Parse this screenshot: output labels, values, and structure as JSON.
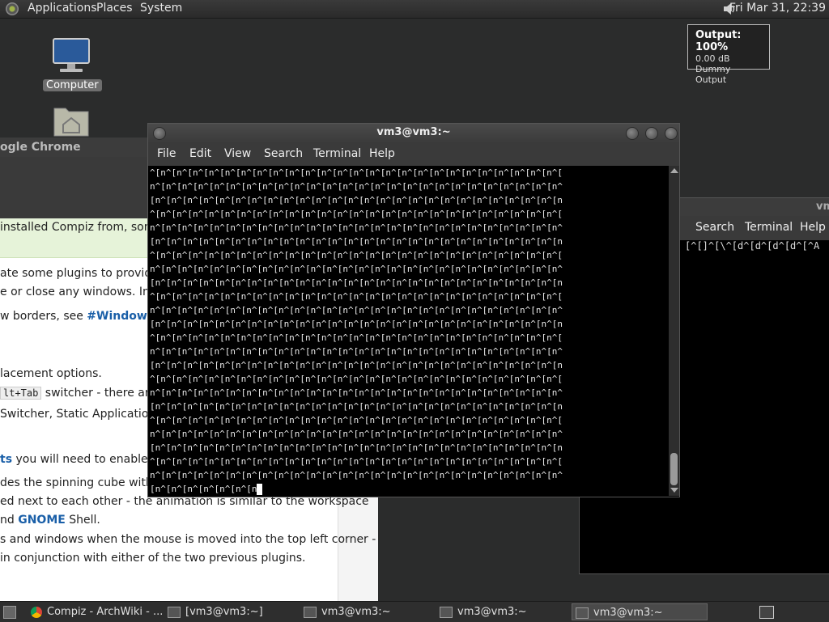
{
  "top_panel": {
    "menus": [
      "Applications",
      "Places",
      "System"
    ],
    "clock": "Fri Mar 31, 22:39"
  },
  "volume_tooltip": {
    "title": "Output: 100%",
    "db": "0.00 dB",
    "device": "Dummy Output"
  },
  "desktop": {
    "computer_label": "Computer"
  },
  "chrome_window": {
    "title_fragment": "ogle Chrome",
    "wiki_lines": [
      "installed Compiz from, some o",
      "ate some plugins to provide b",
      "e or close any windows. Impo",
      "w borders, see ",
      "lacement options.",
      "lt+Tab",
      " switcher - there are",
      "Switcher, Static Application Sw",
      "ts",
      " you will need to enable one",
      "des the spinning cube with ea",
      "ed next to each other - the animation is similar to the workspace",
      "nd ",
      "GNOME",
      " Shell.",
      "s and windows when the mouse is moved into the top left corner -",
      " in conjunction with either of the two previous plugins."
    ],
    "wiki_link": "#Window dec"
  },
  "terminal_bg": {
    "title": "vm",
    "menus": [
      "Search",
      "Terminal",
      "Help"
    ],
    "text": "[^[]^[\\^[d^[d^[d^[d^[^A"
  },
  "terminal": {
    "title": "vm3@vm3:~",
    "menus": [
      "File",
      "Edit",
      "View",
      "Search",
      "Terminal",
      "Help"
    ],
    "lines": [
      "^[n^[n^[n^[n^[n^[n^[n^[n^[n^[n^[n^[n^[n^[n^[n^[n^[n^[n^[n^[n^[n^[n^[n^[n^[n^[",
      "n^[n^[n^[n^[n^[n^[n^[n^[n^[n^[n^[n^[n^[n^[n^[n^[n^[n^[n^[n^[n^[n^[n^[n^[n^[n^",
      "[n^[n^[n^[n^[n^[n^[n^[n^[n^[n^[n^[n^[n^[n^[n^[n^[n^[n^[n^[n^[n^[n^[n^[n^[n^[n",
      "^[n^[n^[n^[n^[n^[n^[n^[n^[n^[n^[n^[n^[n^[n^[n^[n^[n^[n^[n^[n^[n^[n^[n^[n^[n^[",
      "n^[n^[n^[n^[n^[n^[n^[n^[n^[n^[n^[n^[n^[n^[n^[n^[n^[n^[n^[n^[n^[n^[n^[n^[n^[n^",
      "[n^[n^[n^[n^[n^[n^[n^[n^[n^[n^[n^[n^[n^[n^[n^[n^[n^[n^[n^[n^[n^[n^[n^[n^[n^[n",
      "^[n^[n^[n^[n^[n^[n^[n^[n^[n^[n^[n^[n^[n^[n^[n^[n^[n^[n^[n^[n^[n^[n^[n^[n^[n^[",
      "n^[n^[n^[n^[n^[n^[n^[n^[n^[n^[n^[n^[n^[n^[n^[n^[n^[n^[n^[n^[n^[n^[n^[n^[n^[n^",
      "[n^[n^[n^[n^[n^[n^[n^[n^[n^[n^[n^[n^[n^[n^[n^[n^[n^[n^[n^[n^[n^[n^[n^[n^[n^[n",
      "^[n^[n^[n^[n^[n^[n^[n^[n^[n^[n^[n^[n^[n^[n^[n^[n^[n^[n^[n^[n^[n^[n^[n^[n^[n^[",
      "n^[n^[n^[n^[n^[n^[n^[n^[n^[n^[n^[n^[n^[n^[n^[n^[n^[n^[n^[n^[n^[n^[n^[n^[n^[n^",
      "[n^[n^[n^[n^[n^[n^[n^[n^[n^[n^[n^[n^[n^[n^[n^[n^[n^[n^[n^[n^[n^[n^[n^[n^[n^[n",
      "^[n^[n^[n^[n^[n^[n^[n^[n^[n^[n^[n^[n^[n^[n^[n^[n^[n^[n^[n^[n^[n^[n^[n^[n^[n^[",
      "n^[n^[n^[n^[n^[n^[n^[n^[n^[n^[n^[n^[n^[n^[n^[n^[n^[n^[n^[n^[n^[n^[n^[n^[n^[n^",
      "[n^[n^[n^[n^[n^[n^[n^[n^[n^[n^[n^[n^[n^[n^[n^[n^[n^[n^[n^[n^[n^[n^[n^[n^[n^[n",
      "^[n^[n^[n^[n^[n^[n^[n^[n^[n^[n^[n^[n^[n^[n^[n^[n^[n^[n^[n^[n^[n^[n^[n^[n^[n^[",
      "n^[n^[n^[n^[n^[n^[n^[n^[n^[n^[n^[n^[n^[n^[n^[n^[n^[n^[n^[n^[n^[n^[n^[n^[n^[n^",
      "[n^[n^[n^[n^[n^[n^[n^[n^[n^[n^[n^[n^[n^[n^[n^[n^[n^[n^[n^[n^[n^[n^[n^[n^[n^[n",
      "^[n^[n^[n^[n^[n^[n^[n^[n^[n^[n^[n^[n^[n^[n^[n^[n^[n^[n^[n^[n^[n^[n^[n^[n^[n^[",
      "n^[n^[n^[n^[n^[n^[n^[n^[n^[n^[n^[n^[n^[n^[n^[n^[n^[n^[n^[n^[n^[n^[n^[n^[n^[n^",
      "[n^[n^[n^[n^[n^[n^[n^[n^[n^[n^[n^[n^[n^[n^[n^[n^[n^[n^[n^[n^[n^[n^[n^[n^[n^[n",
      "^[n^[n^[n^[n^[n^[n^[n^[n^[n^[n^[n^[n^[n^[n^[n^[n^[n^[n^[n^[n^[n^[n^[n^[n^[n^[",
      "n^[n^[n^[n^[n^[n^[n^[n^[n^[n^[n^[n^[n^[n^[n^[n^[n^[n^[n^[n^[n^[n^[n^[n^[n^[n^"
    ],
    "last_line": "[n^[n^[n^[n^[n^[n^[n"
  },
  "taskbar": {
    "tasks": [
      "Compiz - ArchWiki - ...",
      "[vm3@vm3:~]",
      "vm3@vm3:~",
      "vm3@vm3:~",
      "vm3@vm3:~"
    ]
  }
}
